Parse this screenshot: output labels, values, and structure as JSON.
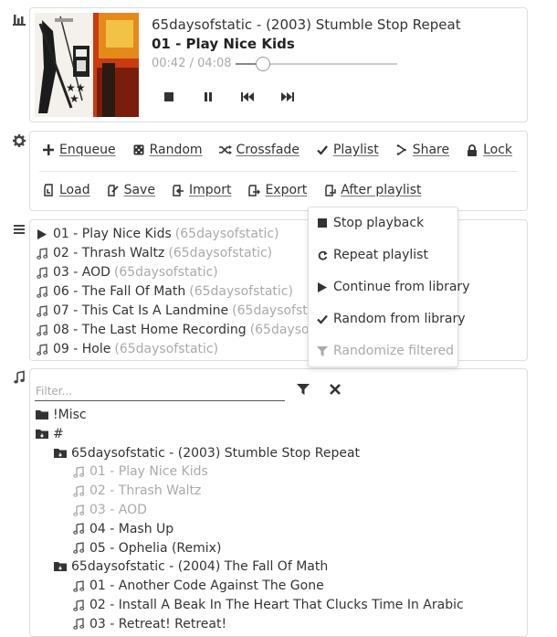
{
  "icons": {
    "player": "bar-chart-icon",
    "options": "gear-icon",
    "playlist": "list-icon",
    "library": "music-note-icon"
  },
  "player": {
    "album": "65daysofstatic - (2003) Stumble Stop Repeat",
    "track": "01 - Play Nice Kids",
    "time": "00:42 / 04:08",
    "progress_fraction": 0.17,
    "controls": [
      "stop-icon",
      "pause-icon",
      "previous-icon",
      "next-icon"
    ]
  },
  "options": {
    "row1": [
      {
        "icon": "plus-icon",
        "label": "Enqueue"
      },
      {
        "icon": "dice-icon",
        "label": "Random"
      },
      {
        "icon": "crossfade-icon",
        "label": "Crossfade"
      },
      {
        "icon": "check-icon",
        "label": "Playlist"
      },
      {
        "icon": "share-icon",
        "label": "Share"
      },
      {
        "icon": "lock-icon",
        "label": "Lock"
      }
    ],
    "row2": [
      {
        "icon": "load-icon",
        "label": "Load"
      },
      {
        "icon": "save-icon",
        "label": "Save"
      },
      {
        "icon": "import-icon",
        "label": "Import"
      },
      {
        "icon": "export-icon",
        "label": "Export"
      },
      {
        "icon": "after-playlist-icon",
        "label": "After playlist"
      }
    ]
  },
  "after_playlist_menu": [
    {
      "icon": "stop-icon",
      "label": "Stop playback",
      "enabled": true
    },
    {
      "icon": "repeat-icon",
      "label": "Repeat playlist",
      "enabled": true
    },
    {
      "icon": "play-icon",
      "label": "Continue from library",
      "enabled": true
    },
    {
      "icon": "check-icon",
      "label": "Random from library",
      "enabled": true
    },
    {
      "icon": "filter-icon",
      "label": "Randomize filtered",
      "enabled": false
    }
  ],
  "playlist": [
    {
      "title": "01 - Play Nice Kids",
      "artist": "(65daysofstatic)",
      "playing": true
    },
    {
      "title": "02 - Thrash Waltz",
      "artist": "(65daysofstatic)",
      "playing": false
    },
    {
      "title": "03 - AOD",
      "artist": "(65daysofstatic)",
      "playing": false
    },
    {
      "title": "06 - The Fall Of Math",
      "artist": "(65daysofstatic)",
      "playing": false
    },
    {
      "title": "07 - This Cat Is A Landmine",
      "artist": "(65daysofstatic)",
      "playing": false
    },
    {
      "title": "08 - The Last Home Recording",
      "artist": "(65daysofstatic)",
      "playing": false
    },
    {
      "title": "09 - Hole",
      "artist": "(65daysofstatic)",
      "playing": false
    }
  ],
  "library": {
    "filter_placeholder": "Filter...",
    "tree": [
      {
        "type": "folder",
        "label": "!Misc",
        "level": 0,
        "dim": false
      },
      {
        "type": "folder-open",
        "label": "#",
        "level": 0,
        "dim": false
      },
      {
        "type": "folder-open",
        "label": "65daysofstatic - (2003) Stumble Stop Repeat",
        "level": 1,
        "dim": false
      },
      {
        "type": "track",
        "label": "01 - Play Nice Kids",
        "level": 2,
        "dim": true
      },
      {
        "type": "track",
        "label": "02 - Thrash Waltz",
        "level": 2,
        "dim": true
      },
      {
        "type": "track",
        "label": "03 - AOD",
        "level": 2,
        "dim": true
      },
      {
        "type": "track",
        "label": "04 - Mash Up",
        "level": 2,
        "dim": false
      },
      {
        "type": "track",
        "label": "05 - Ophelia (Remix)",
        "level": 2,
        "dim": false
      },
      {
        "type": "folder-open",
        "label": "65daysofstatic - (2004) The Fall Of Math",
        "level": 1,
        "dim": false
      },
      {
        "type": "track",
        "label": "01 - Another Code Against The Gone",
        "level": 2,
        "dim": false
      },
      {
        "type": "track",
        "label": "02 - Install A Beak In The Heart That Clucks Time In Arabic",
        "level": 2,
        "dim": false
      },
      {
        "type": "track",
        "label": "03 - Retreat! Retreat!",
        "level": 2,
        "dim": false
      }
    ]
  }
}
